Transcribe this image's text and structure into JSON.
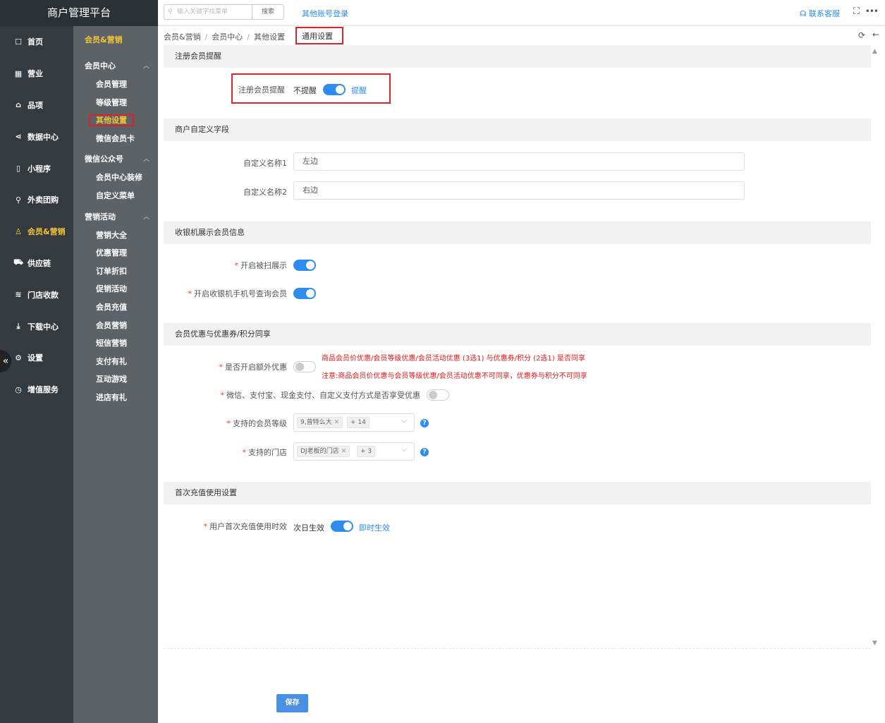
{
  "app": {
    "title": "商户管理平台"
  },
  "nav": [
    {
      "label": "首页",
      "icon": "home-icon",
      "glyph": "☐"
    },
    {
      "label": "营业",
      "icon": "calendar-icon",
      "glyph": "▦"
    },
    {
      "label": "品项",
      "icon": "bag-icon",
      "glyph": "⌂"
    },
    {
      "label": "数据中心",
      "icon": "share-icon",
      "glyph": "⋖"
    },
    {
      "label": "小程序",
      "icon": "phone-icon",
      "glyph": "▯"
    },
    {
      "label": "外卖团购",
      "icon": "bike-icon",
      "glyph": "⚲"
    },
    {
      "label": "会员&营销",
      "icon": "user-icon",
      "glyph": "♙",
      "active": true
    },
    {
      "label": "供应链",
      "icon": "truck-icon",
      "glyph": "⛟"
    },
    {
      "label": "门店收款",
      "icon": "coins-icon",
      "glyph": "≋"
    },
    {
      "label": "下载中心",
      "icon": "download-icon",
      "glyph": "⤓"
    },
    {
      "label": "设置",
      "icon": "gear-icon",
      "glyph": "⚙"
    },
    {
      "label": "增值服务",
      "icon": "clock-icon",
      "glyph": "◷"
    }
  ],
  "subnav": {
    "heading": "会员&营销",
    "groups": [
      {
        "label": "会员中心",
        "items": [
          "会员管理",
          "等级管理",
          "其他设置",
          "微信会员卡"
        ],
        "active": 2
      },
      {
        "label": "微信公众号",
        "items": [
          "会员中心装修",
          "自定义菜单"
        ]
      },
      {
        "label": "营销活动",
        "items": [
          "营销大全",
          "优惠管理",
          "订单折扣",
          "促销活动",
          "会员充值",
          "会员营销",
          "短信营销",
          "支付有礼",
          "互动游戏",
          "进店有礼"
        ]
      }
    ]
  },
  "topbar": {
    "search_placeholder": "输入关键字找菜单",
    "search_button": "搜索",
    "other_login": "其他账号登录",
    "contact": "联系客服"
  },
  "breadcrumb": {
    "items": [
      "会员&营销",
      "会员中心",
      "其他设置"
    ],
    "current": "通用设置"
  },
  "sections": {
    "register": {
      "title": "注册会员提醒",
      "label": "注册会员提醒",
      "off_text": "不提醒",
      "on_text": "提醒"
    },
    "custom": {
      "title": "商户自定义字段",
      "label1": "自定义名称1",
      "value1": "左边",
      "label2": "自定义名称2",
      "value2": "右边"
    },
    "cashier": {
      "title": "收银机展示会员信息",
      "label1": "开启被扫展示",
      "label2": "开启收银机手机号查询会员"
    },
    "discount": {
      "title": "会员优惠与优惠券/积分同享",
      "label1": "是否开启额外优惠",
      "note1": "商品会员价优惠/会员等级优惠/会员活动优惠 (3选1) 与优惠券/积分 (2选1) 是否同享",
      "note2": "注意:商品会员价优惠与会员等级优惠/会员活动优惠不可同享，优惠券与积分不可同享",
      "label2": "微信、支付宝、现金支付、自定义支付方式是否享受优惠",
      "label3": "支持的会员等级",
      "tag3": "9,曾特么大",
      "more3": "+ 14",
      "label4": "支持的门店",
      "tag4": "DJ老板的门店",
      "more4": "+ 3"
    },
    "recharge": {
      "title": "首次充值使用设置",
      "label": "用户首次充值使用时效",
      "off_text": "次日生效",
      "on_text": "即时生效"
    }
  },
  "save_label": "保存",
  "colors": {
    "accent": "#2d8cf0",
    "active_nav": "#f7c531",
    "warning": "#e31a1a"
  }
}
